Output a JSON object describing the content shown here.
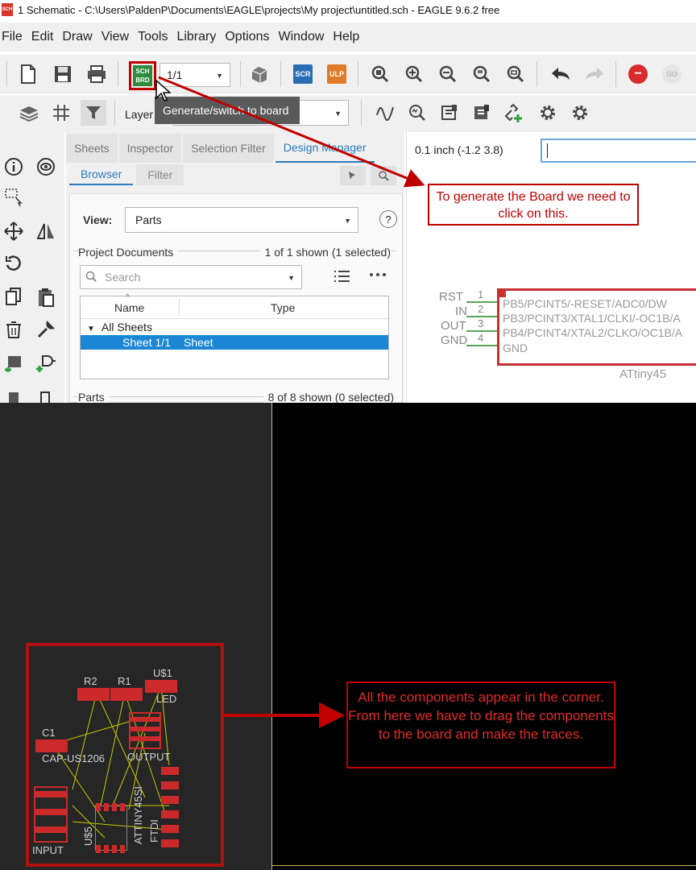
{
  "window": {
    "title": "1 Schematic - C:\\Users\\PaldenP\\Documents\\EAGLE\\projects\\My project\\untitled.sch - EAGLE 9.6.2 free",
    "app_icon": "SCH"
  },
  "menu": [
    "File",
    "Edit",
    "Draw",
    "View",
    "Tools",
    "Library",
    "Options",
    "Window",
    "Help"
  ],
  "toolbar": {
    "sch_brd_top": "SCH",
    "sch_brd_bottom": "BRD",
    "sheet_value": "1/1",
    "scr_label": "SCR",
    "ulp_label": "ULP",
    "go_label": "GO",
    "layer_label": "Layer",
    "tooltip": "Generate/switch to board"
  },
  "panel": {
    "tabs": [
      "Sheets",
      "Inspector",
      "Selection Filter",
      "Design Manager"
    ],
    "active_tab": "Design Manager",
    "sub_tabs": [
      "Browser",
      "Filter"
    ],
    "view_label": "View:",
    "view_value": "Parts",
    "project_docs_label": "Project Documents",
    "project_docs_count": "1 of 1 shown (1 selected)",
    "search_placeholder": "Search",
    "tree_col_name": "Name",
    "tree_col_type": "Type",
    "tree_group": "All Sheets",
    "tree_item_name": "Sheet 1/1",
    "tree_item_type": "Sheet",
    "parts_label": "Parts",
    "parts_count": "8 of 8 shown (0 selected)"
  },
  "schematic": {
    "coord": "0.1 inch (-1.2 3.8)",
    "annotation": "To generate the Board we need to click on this.",
    "pins": [
      {
        "name": "RST",
        "num": "1",
        "desc": "PB5/PCINT5/-RESET/ADC0/DW"
      },
      {
        "name": "IN",
        "num": "2",
        "desc": "PB3/PCINT3/XTAL1/CLKI/-OC1B/A"
      },
      {
        "name": "OUT",
        "num": "3",
        "desc": "PB4/PCINT4/XTAL2/CLKO/OC1B/A"
      },
      {
        "name": "GND",
        "num": "4",
        "desc": "GND"
      }
    ],
    "chip_name": "ATtiny45"
  },
  "board": {
    "annotation": "All the components appear in the corner. From here we have to drag the components to the board and make the traces.",
    "labels": [
      "R2",
      "R1",
      "U$1",
      "LED",
      "C1",
      "CAP-US1206",
      "OUTPUT",
      "ATTINY45SI",
      "FTDI",
      "U$5",
      "INPUT"
    ]
  },
  "colors": {
    "annotation_red": "#c00000",
    "accent_blue": "#2a7bbf",
    "selection_blue": "#1a86d4",
    "board_bg": "#000000",
    "pad_red": "#cc2a2a"
  }
}
